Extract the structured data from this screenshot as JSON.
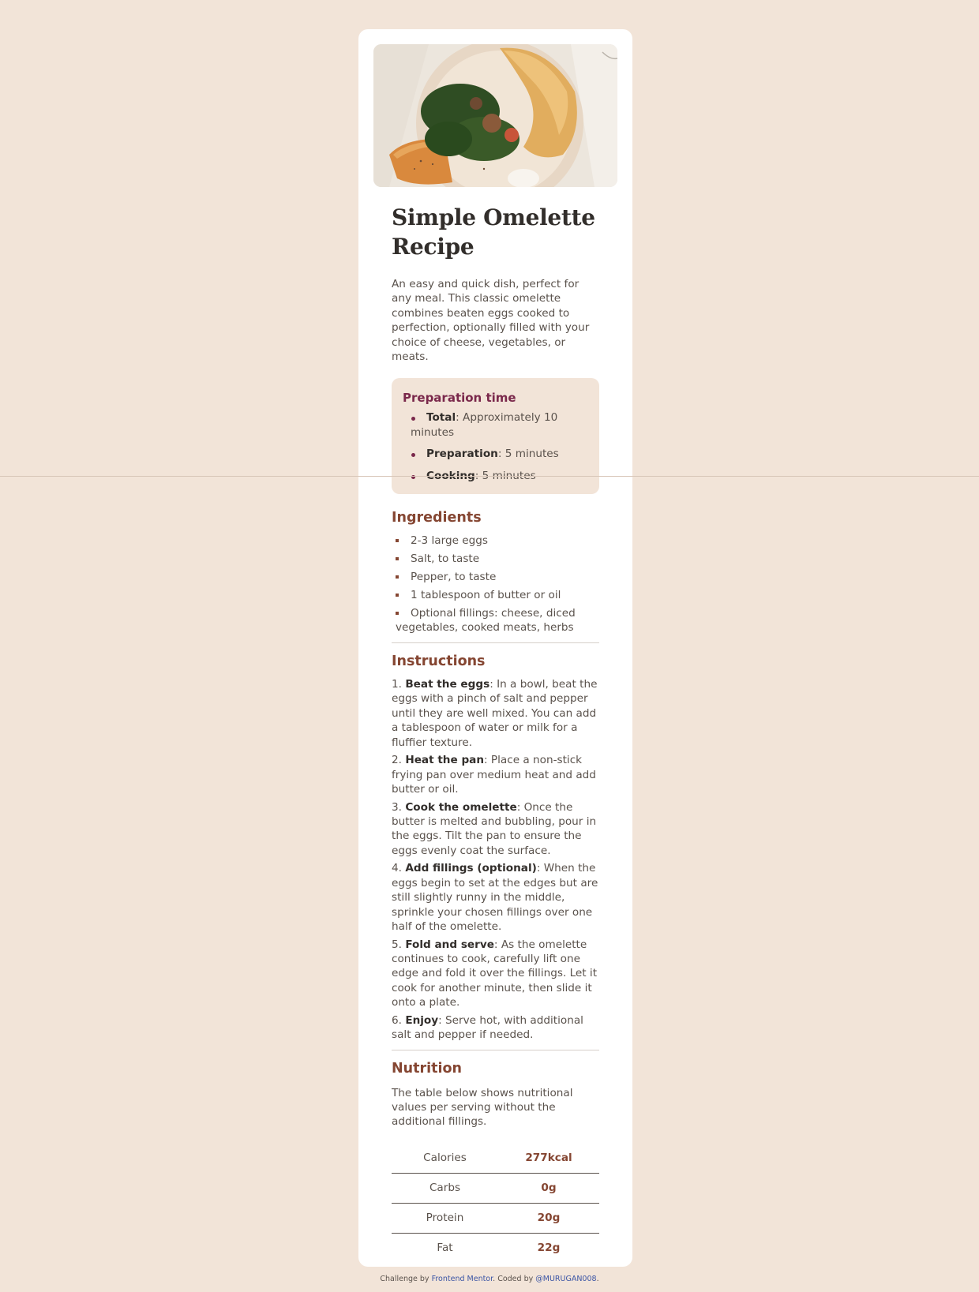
{
  "recipe": {
    "title": "Simple Omelette Recipe",
    "image": {
      "alt": "Omelette with spinach and a toasted slice on a plate"
    },
    "intro": "An easy and quick dish, perfect for any meal. This classic omelette combines beaten eggs cooked to perfection, optionally filled with your choice of cheese, vegetables, or meats.",
    "preparation": {
      "heading": "Preparation time",
      "items": [
        {
          "label": "Total",
          "value": ": Approximately 10 minutes"
        },
        {
          "label": "Preparation",
          "value": ": 5 minutes"
        },
        {
          "label": "Cooking",
          "value": ": 5 minutes"
        }
      ]
    },
    "ingredients": {
      "heading": "Ingredients",
      "items": [
        "2-3 large eggs",
        "Salt, to taste",
        "Pepper, to taste",
        "1 tablespoon of butter or oil",
        "Optional fillings: cheese, diced vegetables, cooked meats, herbs"
      ]
    },
    "instructions": {
      "heading": "Instructions",
      "items": [
        {
          "num": "1.",
          "label": "Beat the eggs",
          "text": ": In a bowl, beat the eggs with a pinch of salt and pepper until they are well mixed. You can add a tablespoon of water or milk for a fluffier texture."
        },
        {
          "num": "2.",
          "label": "Heat the pan",
          "text": ": Place a non-stick frying pan over medium heat and add butter or oil."
        },
        {
          "num": "3.",
          "label": "Cook the omelette",
          "text": ": Once the butter is melted and bubbling, pour in the eggs. Tilt the pan to ensure the eggs evenly coat the surface."
        },
        {
          "num": "4.",
          "label": "Add fillings (optional)",
          "text": ": When the eggs begin to set at the edges but are still slightly runny in the middle, sprinkle your chosen fillings over one half of the omelette."
        },
        {
          "num": "5.",
          "label": "Fold and serve",
          "text": ": As the omelette continues to cook, carefully lift one edge and fold it over the fillings. Let it cook for another minute, then slide it onto a plate."
        },
        {
          "num": "6.",
          "label": "Enjoy",
          "text": ": Serve hot, with additional salt and pepper if needed."
        }
      ]
    },
    "nutrition": {
      "heading": "Nutrition",
      "text": "The table below shows nutritional values per serving without the additional fillings.",
      "rows": [
        {
          "name": "Calories",
          "value": "277kcal"
        },
        {
          "name": "Carbs",
          "value": "0g"
        },
        {
          "name": "Protein",
          "value": "20g"
        },
        {
          "name": "Fat",
          "value": "22g"
        }
      ]
    }
  },
  "footer": {
    "prefix": "Challenge by ",
    "challenge_link": "Frontend Mentor",
    "middle": ". Coded by ",
    "author_link": "@MURUGAN008",
    "suffix": "."
  },
  "colors": {
    "page_background": "#f2e4d8",
    "card_background": "#ffffff",
    "accent_brown": "#854632",
    "accent_plum": "#7a284b",
    "text": "#5a524c",
    "heading": "#322e2b",
    "link": "#3b55a5"
  }
}
